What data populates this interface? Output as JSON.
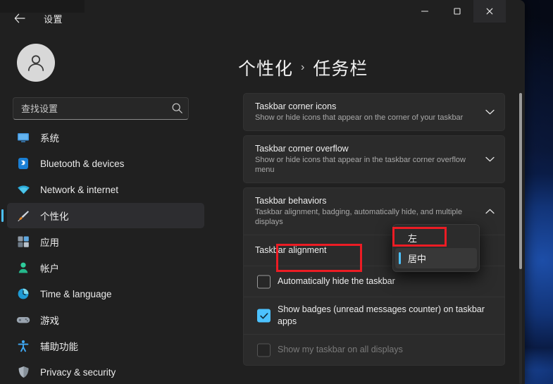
{
  "window": {
    "title": "设置",
    "back_icon": "back-arrow-icon",
    "controls": {
      "minimize": "minimize-icon",
      "maximize": "maximize-icon",
      "close": "close-icon"
    }
  },
  "sidebar": {
    "avatar": "user-avatar-icon",
    "search": {
      "placeholder": "查找设置",
      "value": "",
      "icon": "search-icon"
    },
    "items": [
      {
        "label": "系统",
        "icon": "monitor-icon",
        "selected": false
      },
      {
        "label": "Bluetooth & devices",
        "icon": "bluetooth-icon",
        "selected": false
      },
      {
        "label": "Network & internet",
        "icon": "wifi-icon",
        "selected": false
      },
      {
        "label": "个性化",
        "icon": "paintbrush-icon",
        "selected": true
      },
      {
        "label": "应用",
        "icon": "apps-icon",
        "selected": false
      },
      {
        "label": "帐户",
        "icon": "account-icon",
        "selected": false
      },
      {
        "label": "Time & language",
        "icon": "clock-icon",
        "selected": false
      },
      {
        "label": "游戏",
        "icon": "gamepad-icon",
        "selected": false
      },
      {
        "label": "辅助功能",
        "icon": "accessibility-icon",
        "selected": false
      },
      {
        "label": "Privacy & security",
        "icon": "shield-icon",
        "selected": false
      }
    ]
  },
  "content": {
    "breadcrumb": {
      "parent": "个性化",
      "separator": "›",
      "current": "任务栏"
    },
    "cards": [
      {
        "title": "Taskbar corner icons",
        "subtitle": "Show or hide icons that appear on the corner of your taskbar",
        "chevron": "chevron-down-icon",
        "expanded": false
      },
      {
        "title": "Taskbar corner overflow",
        "subtitle": "Show or hide icons that appear in the taskbar corner overflow menu",
        "chevron": "chevron-down-icon",
        "expanded": false
      },
      {
        "title": "Taskbar behaviors",
        "subtitle": "Taskbar alignment, badging, automatically hide, and multiple displays",
        "chevron": "chevron-up-icon",
        "expanded": true
      }
    ],
    "behavior_rows": {
      "alignment_label": "Taskbar alignment",
      "alignment_value": "居中",
      "autohide_label": "Automatically hide the taskbar",
      "autohide_checked": false,
      "badges_label": "Show badges (unread messages counter) on taskbar apps",
      "badges_checked": true,
      "all_displays_label": "Show my taskbar on all displays",
      "all_displays_checked": false,
      "all_displays_disabled": true
    }
  },
  "dropdown": {
    "options": [
      {
        "label": "左",
        "selected": false
      },
      {
        "label": "居中",
        "selected": true
      }
    ]
  },
  "annotations": {
    "accent_color": "#ec1c24",
    "boxes": [
      {
        "target": "Taskbar alignment"
      },
      {
        "target": "左"
      }
    ]
  },
  "theme": {
    "accent": "#4cc2ff",
    "window_bg": "#202020",
    "card_bg": "#2b2b2b"
  }
}
